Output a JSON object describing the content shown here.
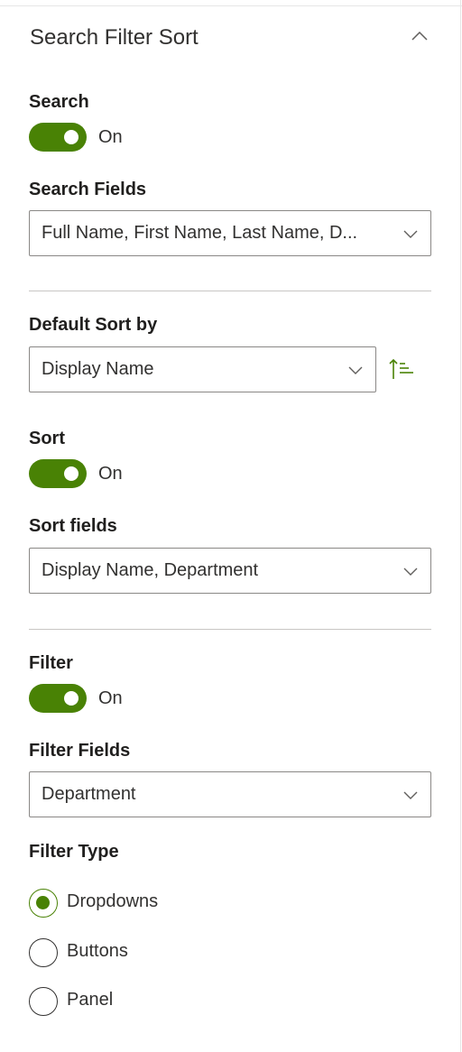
{
  "header": {
    "title": "Search Filter Sort",
    "collapse_icon": "chevron-up-icon"
  },
  "search": {
    "label": "Search",
    "toggle_state": "On",
    "fields_label": "Search Fields",
    "fields_value": "Full Name, First Name, Last Name, D..."
  },
  "sort": {
    "default_label": "Default Sort by",
    "default_value": "Display Name",
    "direction_icon": "sort-ascending-icon",
    "label": "Sort",
    "toggle_state": "On",
    "fields_label": "Sort fields",
    "fields_value": "Display Name, Department"
  },
  "filter": {
    "label": "Filter",
    "toggle_state": "On",
    "fields_label": "Filter Fields",
    "fields_value": "Department",
    "type_label": "Filter Type",
    "type_options": [
      "Dropdowns",
      "Buttons",
      "Panel"
    ],
    "type_selected": "Dropdowns"
  },
  "colors": {
    "accent": "#498205",
    "border": "#8a8886",
    "divider": "#c8c6c4",
    "text": "#201f1e"
  }
}
